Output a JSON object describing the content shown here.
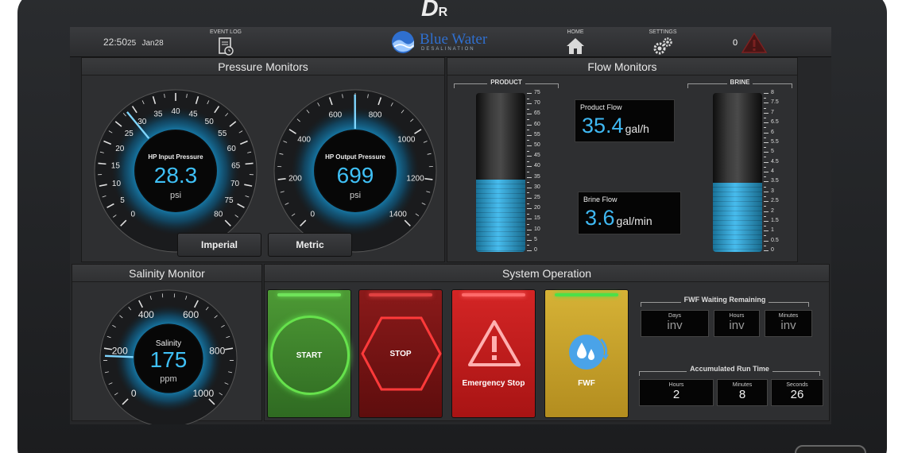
{
  "device": {
    "logo": "D",
    "logo_suffix": "R"
  },
  "header": {
    "time": "22:50",
    "date_day": "25",
    "date_month_day": "Jan28",
    "event_log_label": "EVENT LOG",
    "home_label": "HOME",
    "settings_label": "SETTINGS",
    "brand_name": "Blue Water",
    "brand_sub": "DESALINATION",
    "alarm_count": "0"
  },
  "pressure": {
    "title": "Pressure Monitors",
    "input": {
      "title": "HP Input Pressure",
      "value": "28.3",
      "unit": "psi",
      "min": 0,
      "max": 80,
      "reading": 28.3,
      "tick_labels": [
        "0",
        "5",
        "10",
        "15",
        "20",
        "25",
        "30",
        "35",
        "40",
        "45",
        "50",
        "55",
        "60",
        "65",
        "70",
        "75",
        "80"
      ]
    },
    "output": {
      "title": "HP Output Pressure",
      "value": "699",
      "unit": "psi",
      "min": 0,
      "max": 1400,
      "reading": 699,
      "tick_labels": [
        "0",
        "200",
        "400",
        "600",
        "800",
        "1000",
        "1200",
        "1400"
      ]
    },
    "imperial_label": "Imperial",
    "metric_label": "Metric"
  },
  "flow": {
    "title": "Flow Monitors",
    "product": {
      "label": "PRODUCT",
      "min": 0,
      "max": 75,
      "level": 34,
      "tick_labels": [
        "75",
        "70",
        "65",
        "60",
        "55",
        "50",
        "45",
        "40",
        "35",
        "30",
        "25",
        "20",
        "15",
        "10",
        "5",
        "0"
      ]
    },
    "brine": {
      "label": "BRINE",
      "min": 0,
      "max": 8,
      "level": 3.5,
      "tick_labels": [
        "8",
        "7.5",
        "7",
        "6.5",
        "6",
        "5.5",
        "5",
        "4.5",
        "4",
        "3.5",
        "3",
        "2.5",
        "2",
        "1.5",
        "1",
        "0.5",
        "0"
      ]
    },
    "product_flow": {
      "label": "Product Flow",
      "value": "35.4",
      "unit": "gal/h"
    },
    "brine_flow": {
      "label": "Brine Flow",
      "value": "3.6",
      "unit": "gal/min"
    }
  },
  "salinity": {
    "title": "Salinity Monitor",
    "gauge": {
      "title": "Salinity",
      "value": "175",
      "unit": "ppm",
      "min": 0,
      "max": 1000,
      "reading": 175,
      "tick_labels": [
        "0",
        "200",
        "400",
        "600",
        "800",
        "1000"
      ]
    }
  },
  "system": {
    "title": "System Operation",
    "start_label": "START",
    "stop_label": "STOP",
    "estop_label": "Emergency Stop",
    "fwf_label": "FWF",
    "fwf_waiting": {
      "title": "FWF Waiting Remaining",
      "days_label": "Days",
      "days_value": "inv",
      "hours_label": "Hours",
      "hours_value": "inv",
      "minutes_label": "Minutes",
      "minutes_value": "inv"
    },
    "run_time": {
      "title": "Accumulated Run Time",
      "hours_label": "Hours",
      "hours_value": "2",
      "minutes_label": "Minutes",
      "minutes_value": "8",
      "seconds_label": "Seconds",
      "seconds_value": "26"
    }
  },
  "colors": {
    "accent_blue": "#3fc0f6",
    "start_green": "#3d8a2a",
    "stop_red": "#7a1414",
    "estop_red": "#c81e1e",
    "fwf_yellow": "#c9a62b"
  }
}
